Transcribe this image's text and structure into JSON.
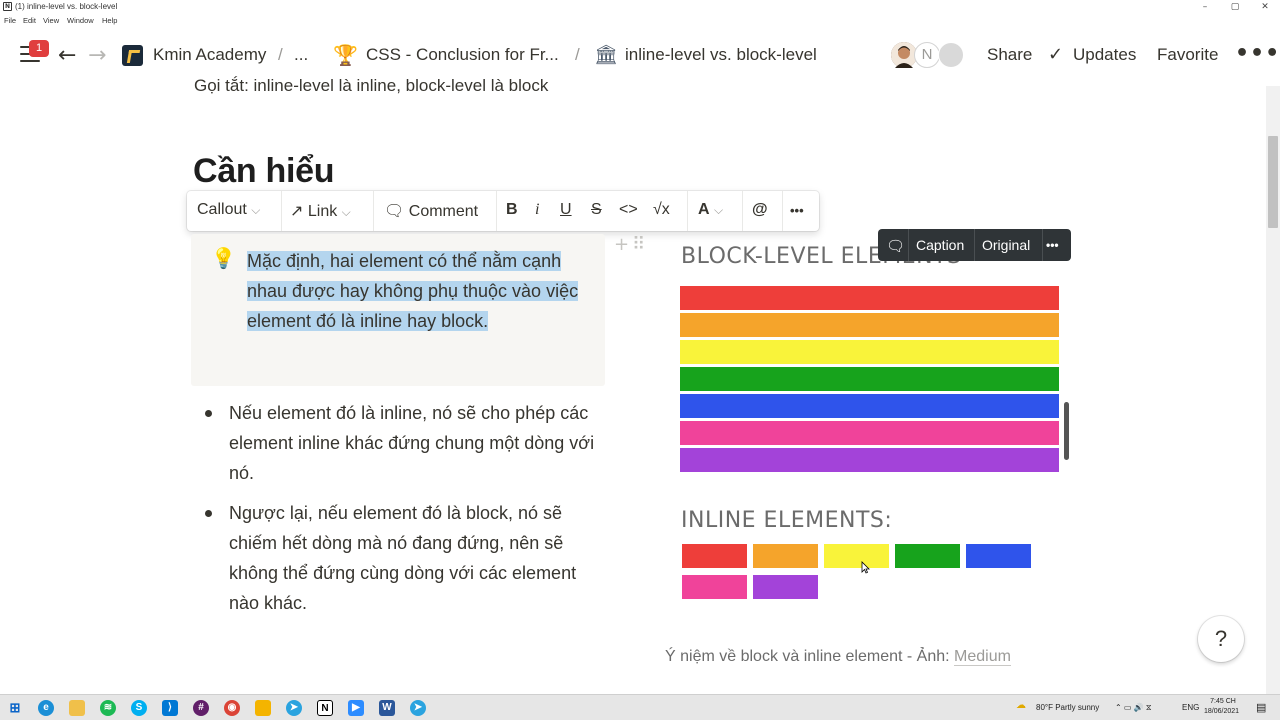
{
  "window": {
    "title": "(1) inline-level vs. block-level",
    "menu": [
      "File",
      "Edit",
      "View",
      "Window",
      "Help"
    ],
    "minimize": "–",
    "maximize": "▢",
    "close": "✕"
  },
  "topbar": {
    "notification_count": "1",
    "breadcrumbs": [
      "Kmin Academy",
      "...",
      "CSS - Conclusion for Fr...",
      "inline-level vs. block-level"
    ],
    "separators": [
      "/",
      "/",
      "/"
    ],
    "avatar_initials": "N",
    "actions": {
      "share": "Share",
      "updates": "Updates",
      "favorite": "Favorite",
      "more": "•••"
    }
  },
  "page": {
    "cut_text": "Gọi tắt: inline-level là inline, block-level là block",
    "heading": "Cần hiểu",
    "callout_text": "Mặc định, hai element có thể nằm cạnh nhau được hay không phụ thuộc vào việc element đó là inline hay block.",
    "bullets": [
      "Nếu element đó là inline, nó sẽ cho phép các element inline khác đứng chung một dòng với nó.",
      "Ngược lại, nếu element đó là block, nó sẽ chiếm hết dòng mà nó đang đứng, nên sẽ không thể đứng cùng dòng với các element nào khác."
    ]
  },
  "toolbar": {
    "callout": "Callout",
    "link": "Link",
    "comment": "Comment",
    "bold": "B",
    "italic": "i",
    "underline": "U",
    "strike": "S",
    "code": "<>",
    "math": "√x",
    "color": "A",
    "mention": "@",
    "more": "•••"
  },
  "image_toolbar": {
    "caption": "Caption",
    "original": "Original",
    "more": "•••"
  },
  "figure": {
    "block_title": "BLOCK-LEVEL ELEMENTS",
    "inline_title": "INLINE ELEMENTS:",
    "colors": [
      "#ee3e3a",
      "#f5a42b",
      "#f9f33a",
      "#17a31c",
      "#2f54eb",
      "#f0439a",
      "#a343d9"
    ],
    "caption_text": "Ý niệm về block và inline element - Ảnh: ",
    "caption_link": "Medium"
  },
  "help": "?",
  "taskbar": {
    "weather": "80°F  Partly sunny",
    "lang": "ENG",
    "time": "7:45 CH",
    "date": "18/06/2021"
  }
}
